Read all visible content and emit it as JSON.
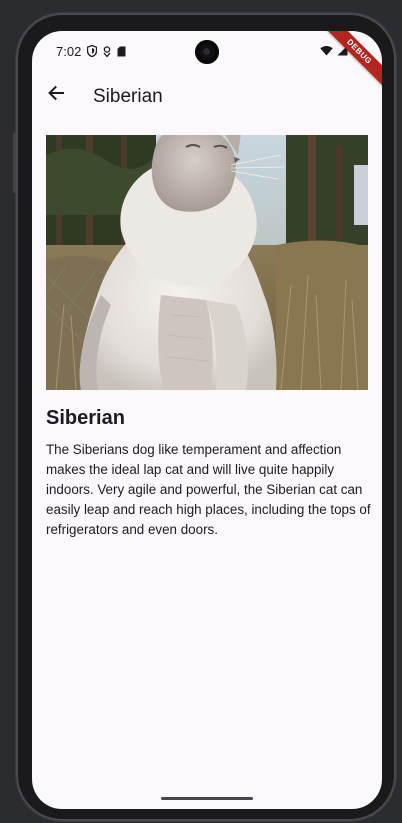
{
  "status_bar": {
    "time": "7:02",
    "icons_left": [
      "shield-icon",
      "location-icon",
      "sim-card-icon"
    ],
    "icons_right": [
      "wifi-icon",
      "signal-icon",
      "battery-icon"
    ],
    "debug_banner": "DEBUG"
  },
  "app_bar": {
    "back_icon": "arrow-back-icon",
    "title": "Siberian"
  },
  "content": {
    "image_subject": "Siberian cat photo",
    "breed_name": "Siberian",
    "description": "The Siberians dog like temperament and affection makes the ideal lap cat and will live quite happily indoors. Very agile and powerful, the Siberian cat can easily leap and reach high places, including the tops of refrigerators and even doors."
  },
  "colors": {
    "background": "#fdf7fe",
    "text": "#1d1b20",
    "debug": "#b3261e"
  }
}
